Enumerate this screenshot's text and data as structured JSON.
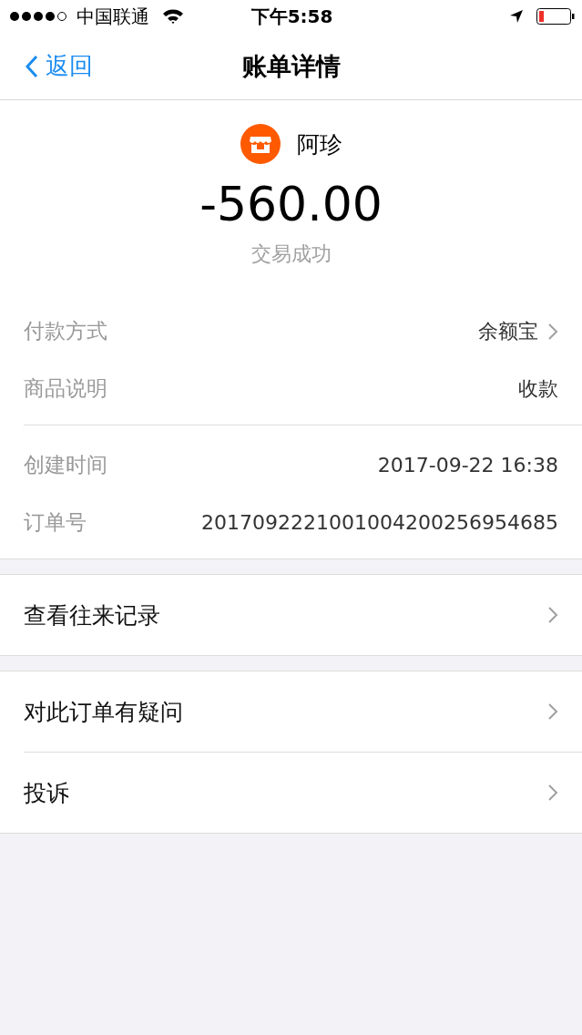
{
  "status_bar": {
    "carrier": "中国联通",
    "time": "下午5:58"
  },
  "nav": {
    "back": "返回",
    "title": "账单详情"
  },
  "merchant": {
    "name": "阿珍"
  },
  "amount": "-560.00",
  "status": "交易成功",
  "detail_groups": [
    [
      {
        "label": "付款方式",
        "value": "余额宝",
        "link": true
      },
      {
        "label": "商品说明",
        "value": "收款",
        "link": false
      }
    ],
    [
      {
        "label": "创建时间",
        "value": "2017-09-22 16:38",
        "link": false
      },
      {
        "label": "订单号",
        "value": "2017092221001004200256954685",
        "link": false
      }
    ]
  ],
  "action_groups": [
    [
      {
        "label": "查看往来记录"
      }
    ],
    [
      {
        "label": "对此订单有疑问"
      },
      {
        "label": "投诉"
      }
    ]
  ]
}
